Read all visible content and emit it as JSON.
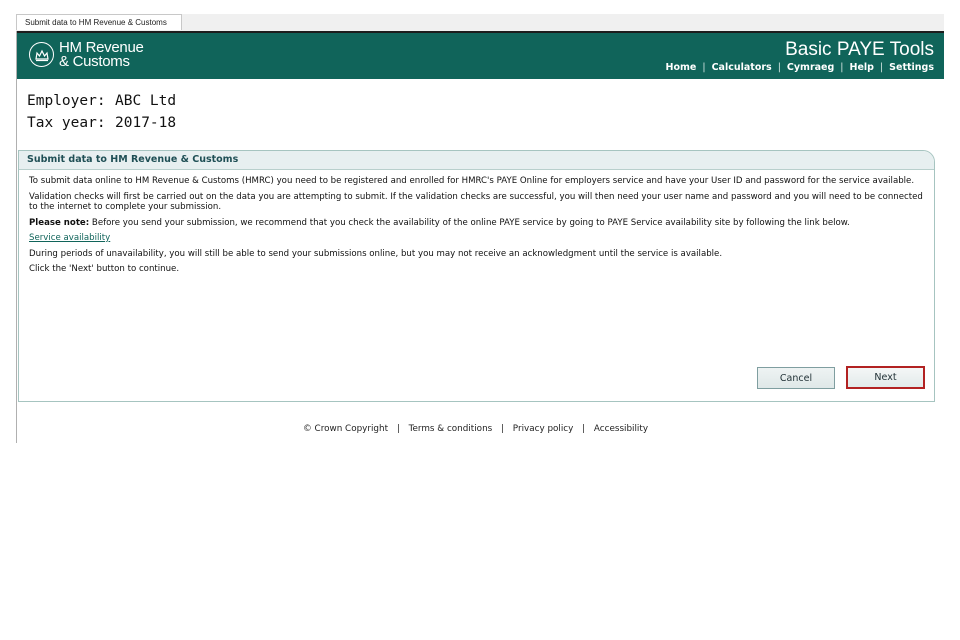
{
  "window": {
    "tab_title": "Submit data to HM Revenue & Customs"
  },
  "header": {
    "logo_line1": "HM Revenue",
    "logo_line2": "& Customs",
    "app_title": "Basic PAYE Tools",
    "nav": [
      "Home",
      "Calculators",
      "Cymraeg",
      "Help",
      "Settings"
    ],
    "background_color": "#10645a"
  },
  "info": {
    "employer_label": "Employer:",
    "employer_value": "ABC Ltd",
    "tax_year_label": "Tax year:",
    "tax_year_value": "2017-18"
  },
  "panel": {
    "title": "Submit data to HM Revenue & Customs",
    "para1": "To submit data online to HM Revenue & Customs (HMRC) you need to be registered and enrolled for HMRC's PAYE Online for employers service and have your User ID and password for the service available.",
    "para2": "Validation checks will first be carried out on the data you are attempting to submit. If the validation checks are successful, you will then need your user name and password and you will need to be connected to the internet to complete your submission.",
    "note_label": "Please note:",
    "note_text": " Before you send your submission, we recommend that you check the availability of the online PAYE service by going to PAYE Service availability site by following the link below.",
    "service_link": "Service availability",
    "para4": "During periods of unavailability, you will still be able to send your submissions online, but you may not receive an acknowledgment until the service is available.",
    "para5": "Click the 'Next' button to continue."
  },
  "buttons": {
    "cancel": "Cancel",
    "next": "Next"
  },
  "footer": {
    "copyright": "© Crown Copyright",
    "terms": "Terms & conditions",
    "privacy": "Privacy policy",
    "accessibility": "Accessibility"
  }
}
